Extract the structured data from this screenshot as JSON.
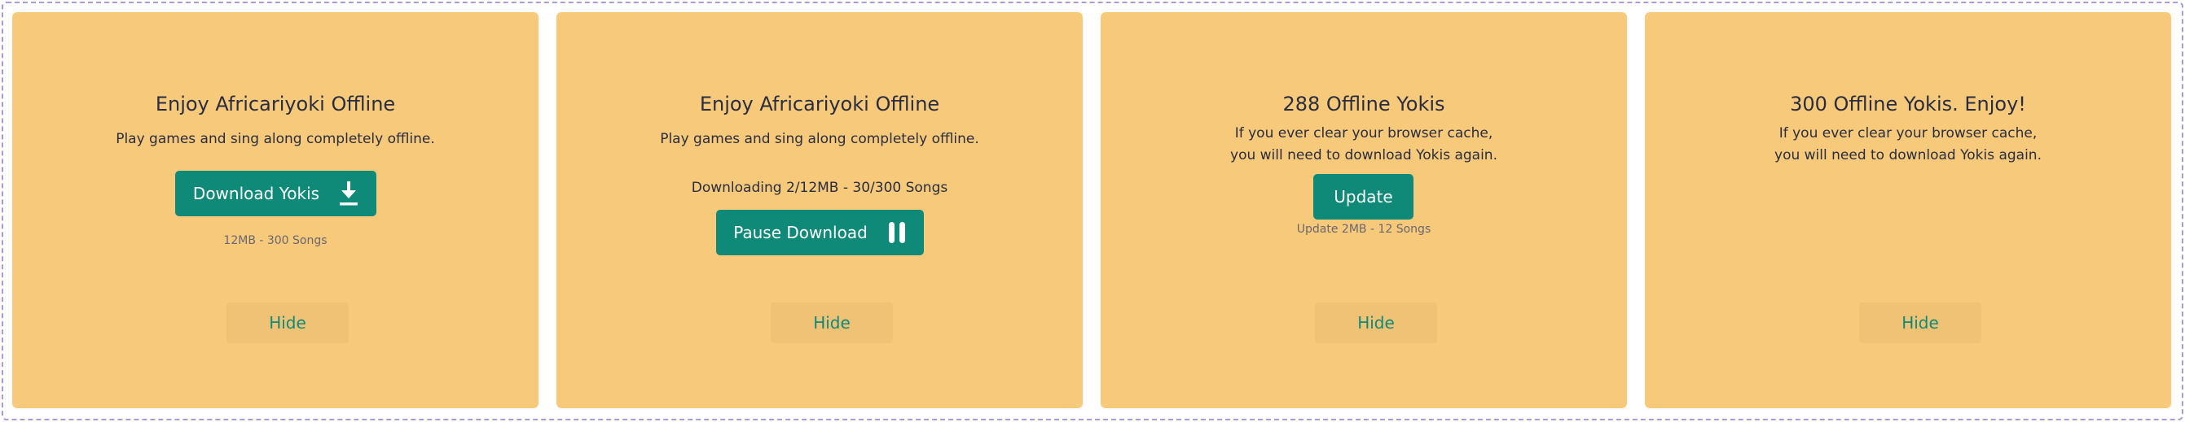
{
  "cards": [
    {
      "title": "Enjoy Africariyoki Offline",
      "description": "Play games and sing along completely offline.",
      "button_label": "Download Yokis",
      "button_icon": "download-icon",
      "note": "12MB - 300 Songs",
      "hide_label": "Hide"
    },
    {
      "title": "Enjoy Africariyoki Offline",
      "description": "Play games and sing along completely offline.",
      "status": "Downloading 2/12MB - 30/300 Songs",
      "download_progress": 0.1,
      "button_label": "Pause Download",
      "button_icon": "pause-icon",
      "hide_label": "Hide"
    },
    {
      "title": "288 Offline Yokis",
      "description_lines": [
        "If you ever clear your browser cache,",
        "you will need to download Yokis again."
      ],
      "button_label": "Update",
      "note": "Update 2MB - 12 Songs",
      "hide_label": "Hide"
    },
    {
      "title": "300 Offline Yokis. Enjoy!",
      "description_lines": [
        "If you ever clear your browser cache,",
        "you will need to download Yokis again."
      ],
      "hide_label": "Hide"
    }
  ],
  "colors": {
    "card_background": "#f7c97b",
    "accent": "#0f8a78",
    "hide_button_background": "#efc275",
    "text": "#2a2d3f",
    "frame_border": "#a79bd8"
  }
}
